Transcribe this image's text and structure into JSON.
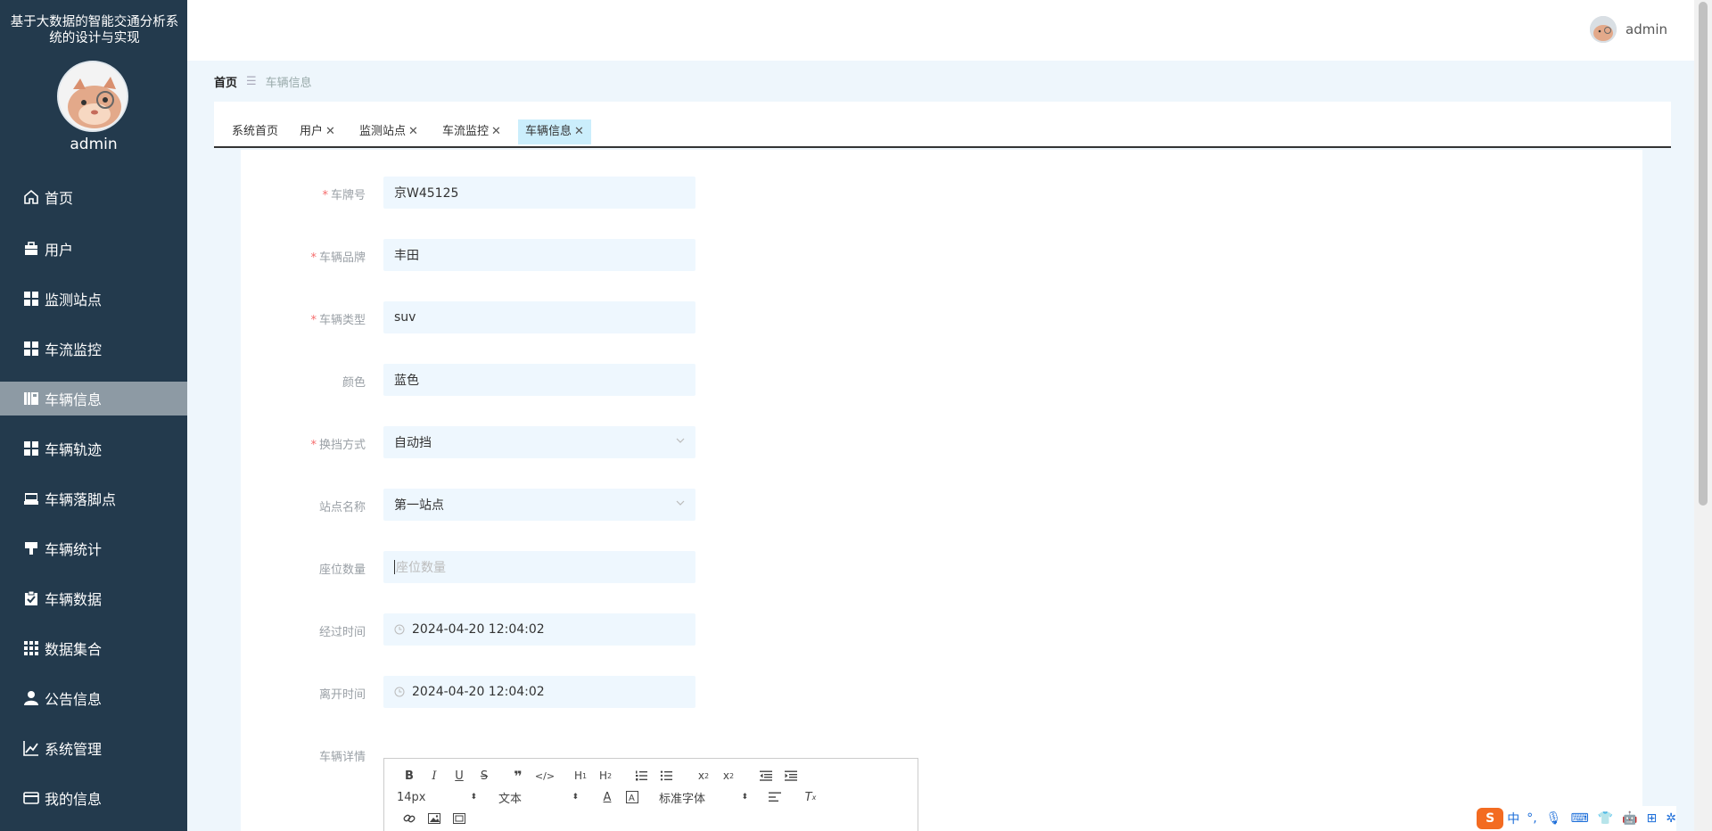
{
  "sidebar": {
    "title": "基于大数据的智能交通分析系统的设计与实现",
    "username": "admin",
    "items": [
      {
        "label": "首页",
        "icon": "home-icon"
      },
      {
        "label": "用户",
        "icon": "briefcase-icon"
      },
      {
        "label": "监测站点",
        "icon": "grid-icon"
      },
      {
        "label": "车流监控",
        "icon": "grid-icon"
      },
      {
        "label": "车辆信息",
        "icon": "book-icon",
        "active": true
      },
      {
        "label": "车辆轨迹",
        "icon": "grid-icon"
      },
      {
        "label": "车辆落脚点",
        "icon": "inbox-icon"
      },
      {
        "label": "车辆统计",
        "icon": "stamp-icon"
      },
      {
        "label": "车辆数据",
        "icon": "clipboard-check-icon"
      },
      {
        "label": "数据集合",
        "icon": "apps-icon"
      },
      {
        "label": "公告信息",
        "icon": "person-icon"
      },
      {
        "label": "系统管理",
        "icon": "chart-line-icon"
      },
      {
        "label": "我的信息",
        "icon": "card-icon"
      }
    ]
  },
  "topbar": {
    "username": "admin"
  },
  "breadcrumb": {
    "home": "首页",
    "current": "车辆信息"
  },
  "tabs": [
    {
      "label": "系统首页",
      "closable": false
    },
    {
      "label": "用户",
      "closable": true
    },
    {
      "label": "监测站点",
      "closable": true
    },
    {
      "label": "车流监控",
      "closable": true
    },
    {
      "label": "车辆信息",
      "closable": true,
      "active": true
    }
  ],
  "form": {
    "plate": {
      "label": "车牌号",
      "required": true,
      "value": "京W45125"
    },
    "brand": {
      "label": "车辆品牌",
      "required": true,
      "value": "丰田"
    },
    "type": {
      "label": "车辆类型",
      "required": true,
      "value": "suv"
    },
    "color": {
      "label": "颜色",
      "required": false,
      "value": "蓝色"
    },
    "gear": {
      "label": "换挡方式",
      "required": true,
      "value": "自动挡"
    },
    "station": {
      "label": "站点名称",
      "required": false,
      "value": "第一站点"
    },
    "seats": {
      "label": "座位数量",
      "required": false,
      "placeholder": "座位数量"
    },
    "pass_time": {
      "label": "经过时间",
      "required": false,
      "value": "2024-04-20 12:04:02"
    },
    "leave_time": {
      "label": "离开时间",
      "required": false,
      "value": "2024-04-20 12:04:02"
    },
    "details": {
      "label": "车辆详情"
    }
  },
  "editor": {
    "font_size": "14px",
    "header": "文本",
    "font": "标准字体"
  },
  "ime": {
    "lang": "中"
  },
  "colors": {
    "sidebar_bg": "#233a4d",
    "active_item": "#8d9aa4",
    "active_tab": "#cbeefc",
    "required": "#f56c6c",
    "input_bg": "#eef7fe"
  }
}
